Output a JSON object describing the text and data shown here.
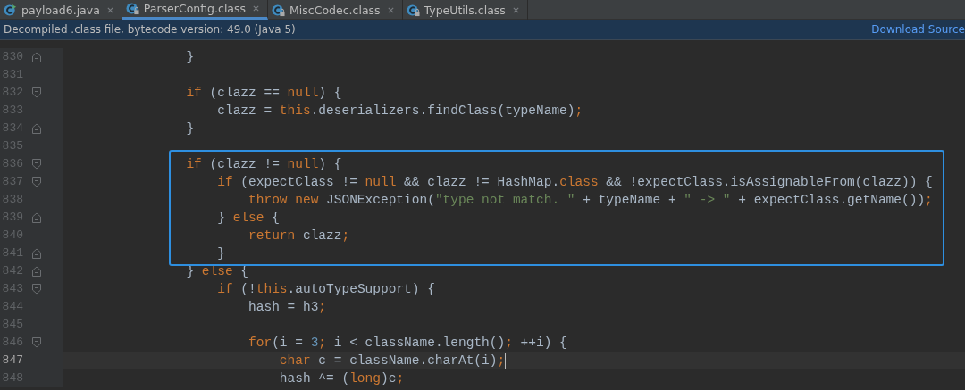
{
  "tabs": [
    {
      "label": "payload6.java",
      "kind": "java",
      "selected": false
    },
    {
      "label": "ParserConfig.class",
      "kind": "class",
      "selected": true
    },
    {
      "label": "MiscCodec.class",
      "kind": "class",
      "selected": false
    },
    {
      "label": "TypeUtils.class",
      "kind": "class",
      "selected": false
    }
  ],
  "banner": {
    "message": "Decompiled .class file, bytecode version: 49.0 (Java 5)",
    "link": "Download Source"
  },
  "lines": [
    {
      "number": "830",
      "kind": "fold_end",
      "tokens": [
        {
          "kind": "plain",
          "text": "            }"
        }
      ]
    },
    {
      "number": "831",
      "kind": "plain"
    },
    {
      "number": "832",
      "kind": "fold_start",
      "tokens": [
        {
          "kind": "keyword",
          "text": "            if"
        },
        {
          "kind": "plain",
          "text": " (clazz == "
        },
        {
          "kind": "keyword",
          "text": "null"
        },
        {
          "kind": "plain",
          "text": ") {"
        }
      ]
    },
    {
      "number": "833",
      "kind": "plain",
      "tokens": [
        {
          "kind": "plain",
          "text": "                clazz = "
        },
        {
          "kind": "keyword",
          "text": "this"
        },
        {
          "kind": "plain",
          "text": ".deserializers.findClass(typeName)"
        },
        {
          "kind": "keyword",
          "text": ";"
        }
      ]
    },
    {
      "number": "834",
      "kind": "fold_end",
      "tokens": [
        {
          "kind": "plain",
          "text": "            }"
        }
      ]
    },
    {
      "number": "835",
      "kind": "plain"
    },
    {
      "number": "836",
      "kind": "fold_start",
      "highlighted": true,
      "tokens": [
        {
          "kind": "keyword",
          "text": "            if"
        },
        {
          "kind": "plain",
          "text": " (clazz != "
        },
        {
          "kind": "keyword",
          "text": "null"
        },
        {
          "kind": "plain",
          "text": ") {"
        }
      ]
    },
    {
      "number": "837",
      "kind": "fold_start",
      "highlighted": true,
      "tokens": [
        {
          "kind": "keyword",
          "text": "                if"
        },
        {
          "kind": "plain",
          "text": " (expectClass != "
        },
        {
          "kind": "keyword",
          "text": "null"
        },
        {
          "kind": "plain",
          "text": " && clazz != HashMap."
        },
        {
          "kind": "keyword",
          "text": "class"
        },
        {
          "kind": "plain",
          "text": " && !expectClass.isAssignableFrom(clazz)) {"
        }
      ]
    },
    {
      "number": "838",
      "kind": "plain",
      "highlighted": true,
      "tokens": [
        {
          "kind": "keyword",
          "text": "                    throw new"
        },
        {
          "kind": "plain",
          "text": " JSONException("
        },
        {
          "kind": "string",
          "text": "\"type not match. \""
        },
        {
          "kind": "plain",
          "text": " + typeName + "
        },
        {
          "kind": "string",
          "text": "\" -> \""
        },
        {
          "kind": "plain",
          "text": " + expectClass.getName())"
        },
        {
          "kind": "keyword",
          "text": ";"
        }
      ]
    },
    {
      "number": "839",
      "kind": "fold_end",
      "highlighted": true,
      "tokens": [
        {
          "kind": "plain",
          "text": "                } "
        },
        {
          "kind": "keyword",
          "text": "else"
        },
        {
          "kind": "plain",
          "text": " {"
        }
      ]
    },
    {
      "number": "840",
      "kind": "plain",
      "highlighted": true,
      "tokens": [
        {
          "kind": "keyword",
          "text": "                    return"
        },
        {
          "kind": "plain",
          "text": " clazz"
        },
        {
          "kind": "keyword",
          "text": ";"
        }
      ]
    },
    {
      "number": "841",
      "kind": "fold_end",
      "highlighted": true,
      "tokens": [
        {
          "kind": "plain",
          "text": "                }"
        }
      ]
    },
    {
      "number": "842",
      "kind": "fold_end",
      "tokens": [
        {
          "kind": "plain",
          "text": "            } "
        },
        {
          "kind": "keyword",
          "text": "else"
        },
        {
          "kind": "plain",
          "text": " {"
        }
      ]
    },
    {
      "number": "843",
      "kind": "fold_start",
      "tokens": [
        {
          "kind": "keyword",
          "text": "                if"
        },
        {
          "kind": "plain",
          "text": " (!"
        },
        {
          "kind": "keyword",
          "text": "this"
        },
        {
          "kind": "plain",
          "text": ".autoTypeSupport) {"
        }
      ]
    },
    {
      "number": "844",
      "kind": "plain",
      "tokens": [
        {
          "kind": "plain",
          "text": "                    hash = h3"
        },
        {
          "kind": "keyword",
          "text": ";"
        }
      ]
    },
    {
      "number": "845",
      "kind": "plain"
    },
    {
      "number": "846",
      "kind": "fold_start",
      "tokens": [
        {
          "kind": "keyword",
          "text": "                    for"
        },
        {
          "kind": "plain",
          "text": "(i = "
        },
        {
          "kind": "number",
          "text": "3"
        },
        {
          "kind": "keyword",
          "text": ";"
        },
        {
          "kind": "plain",
          "text": " i < className.length()"
        },
        {
          "kind": "keyword",
          "text": ";"
        },
        {
          "kind": "plain",
          "text": " ++i) {"
        }
      ]
    },
    {
      "number": "847",
      "kind": "plain",
      "current": true,
      "caret": true,
      "tokens": [
        {
          "kind": "keyword",
          "text": "                        char"
        },
        {
          "kind": "plain",
          "text": " c = className.charAt(i)"
        },
        {
          "kind": "keyword",
          "text": ";"
        }
      ]
    },
    {
      "number": "848",
      "kind": "plain",
      "tokens": [
        {
          "kind": "plain",
          "text": "                        hash ^= ("
        },
        {
          "kind": "keyword",
          "text": "long"
        },
        {
          "kind": "plain",
          "text": ")c"
        },
        {
          "kind": "keyword",
          "text": ";"
        }
      ]
    }
  ]
}
